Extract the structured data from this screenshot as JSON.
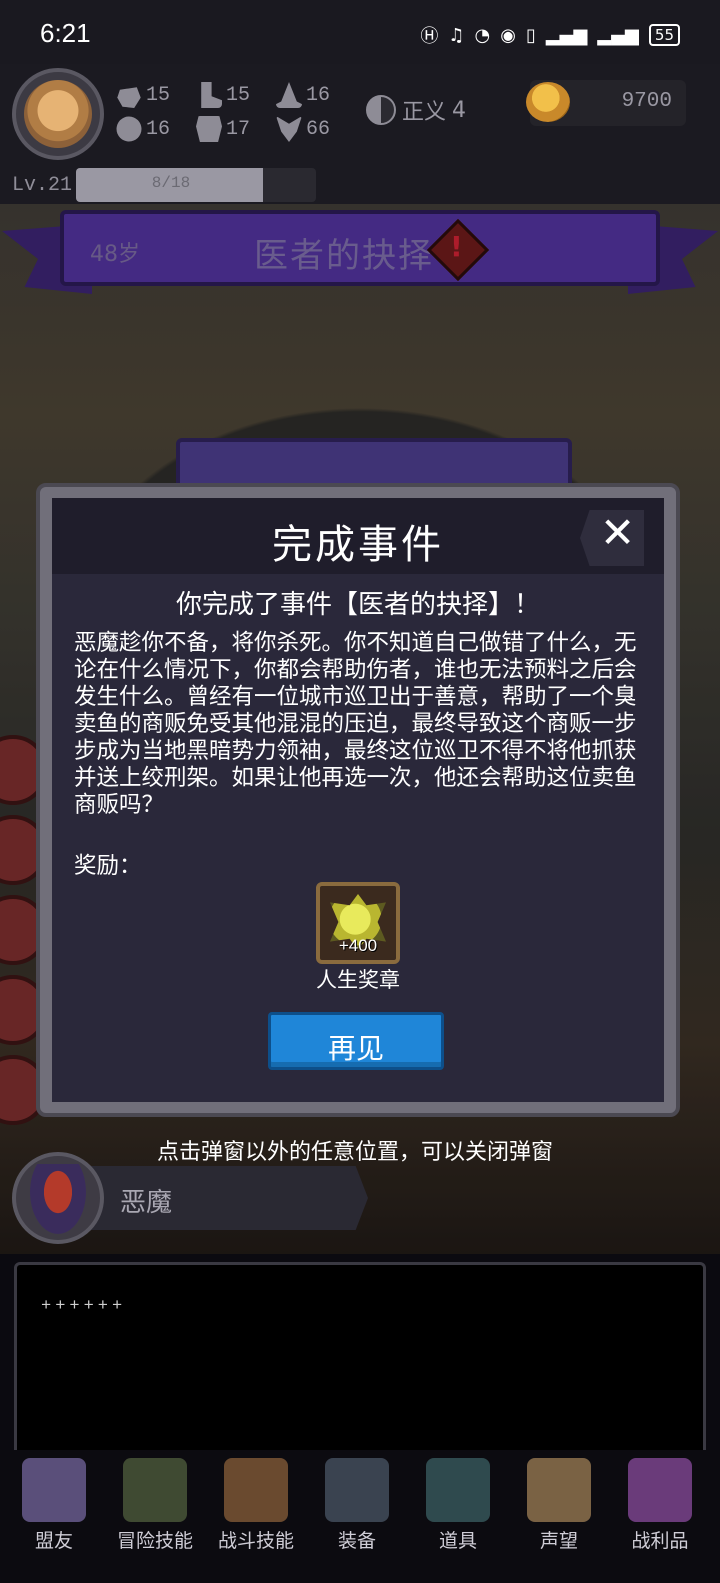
{
  "status_bar": {
    "time": "6:21",
    "icons": [
      "hd-icon",
      "headphones-icon",
      "speed-icon",
      "eye-icon",
      "vibrate-icon",
      "signal-4g-icon",
      "signal-4g-icon"
    ],
    "battery": "55"
  },
  "player": {
    "stats": [
      {
        "icon": "fist-icon",
        "value": "15"
      },
      {
        "icon": "boot-icon",
        "value": "15"
      },
      {
        "icon": "wizard-hat-icon",
        "value": "16"
      },
      {
        "icon": "clover-icon",
        "value": "16"
      },
      {
        "icon": "armor-icon",
        "value": "17"
      },
      {
        "icon": "wings-icon",
        "value": "66"
      }
    ],
    "alignment": {
      "label": "正义",
      "value": "4"
    },
    "gold": "9700",
    "level": "Lv.21",
    "xp_text": "8/18",
    "xp_fraction": 0.78
  },
  "event_banner": {
    "age": "48岁",
    "title": "医者的抉择",
    "icon": "warning-icon"
  },
  "modal": {
    "title": "完成事件",
    "subtitle": "你完成了事件【医者的抉择】！",
    "body": "恶魔趁你不备，将你杀死。你不知道自己做错了什么，无论在什么情况下，你都会帮助伤者，谁也无法预料之后会发生什么。曾经有一位城市巡卫出于善意，帮助了一个臭卖鱼的商贩免受其他混混的压迫，最终导致这个商贩一步步成为当地黑暗势力领袖，最终这位巡卫不得不将他抓获并送上绞刑架。如果让他再选一次，他还会帮助这位卖鱼商贩吗？",
    "reward_label": "奖励：",
    "reward": {
      "amount": "+400",
      "name": "人生奖章",
      "icon": "medal-icon"
    },
    "button": "再见"
  },
  "hint": "点击弹窗以外的任意位置，可以关闭弹窗",
  "npc": {
    "name": "恶魔"
  },
  "log": {
    "text": "++++++"
  },
  "nav": [
    {
      "label": "盟友",
      "icon": "handshake-icon",
      "color": "#5a4f7a"
    },
    {
      "label": "冒险技能",
      "icon": "book-icon",
      "color": "#3f4a32"
    },
    {
      "label": "战斗技能",
      "icon": "backpack-icon",
      "color": "#6a4a2f"
    },
    {
      "label": "装备",
      "icon": "swords-icon",
      "color": "#3a4350"
    },
    {
      "label": "道具",
      "icon": "pouch-icon",
      "color": "#2f4a4e"
    },
    {
      "label": "声望",
      "icon": "scroll-icon",
      "color": "#7a6244"
    },
    {
      "label": "战利品",
      "icon": "chest-icon",
      "color": "#6a3b7a"
    }
  ]
}
